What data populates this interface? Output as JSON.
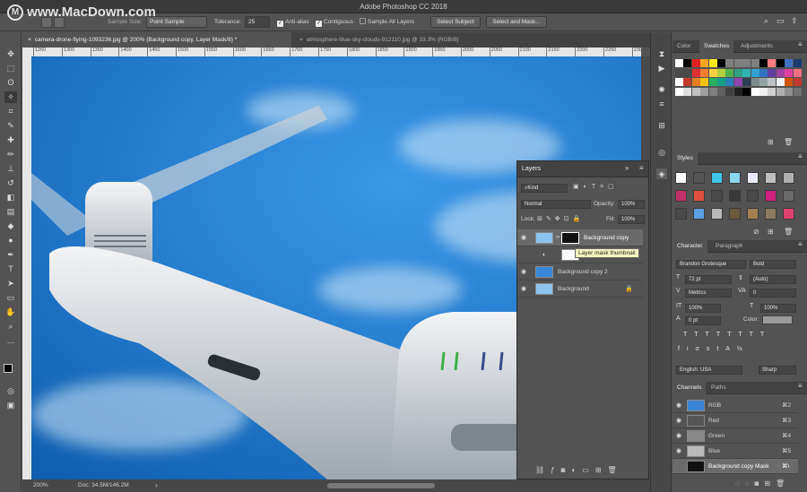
{
  "window": {
    "title": "Adobe Photoshop CC 2018",
    "watermark": "www.MacDown.com"
  },
  "options": {
    "sample_size_label": "Sample Size:",
    "sample_size_value": "Point Sample",
    "tolerance_label": "Tolerance:",
    "tolerance_value": "25",
    "anti_alias": "Anti-alias",
    "contiguous": "Contiguous",
    "sample_all_layers": "Sample All Layers",
    "select_subject": "Select Subject",
    "select_and_mask": "Select and Mask..."
  },
  "tabs": [
    {
      "label": "camera-drone-flying-1093236.jpg @ 200% (Background copy, Layer Mask/8) *",
      "active": true
    },
    {
      "label": "atmosphere-blue-sky-clouds-912110.jpg @ 33.3% (RGB/8)",
      "active": false
    }
  ],
  "ruler": [
    "1260",
    "1300",
    "1350",
    "1400",
    "1450",
    "1500",
    "1550",
    "1600",
    "1650",
    "1700",
    "1750",
    "1800",
    "1850",
    "1900",
    "1950",
    "2000",
    "2050",
    "2100",
    "2150",
    "2200",
    "2250",
    "2300"
  ],
  "status": {
    "zoom": "200%",
    "doc": "Doc: 34.5M/146.2M"
  },
  "swatches_panel": {
    "tabs": [
      "Color",
      "Swatches",
      "Adjustments"
    ],
    "active": "Swatches",
    "rows": [
      [
        "#ffffff",
        "#000000",
        "#e02020",
        "#f5a623",
        "#f8e71c",
        "#000000",
        "#7f7f7f",
        "#7f7f7f",
        "#7f7f7f",
        "#7f7f7f",
        "#000000",
        "#ff7f7f",
        "#000000",
        "#3f6fbf",
        "#1a3a6f"
      ],
      [
        "#4a4a4a",
        "#4a4a4a",
        "#e03030",
        "#f08030",
        "#f8d040",
        "#b0d040",
        "#50b050",
        "#30a080",
        "#30b0b0",
        "#30a0d0",
        "#3070c0",
        "#6040a0",
        "#a040a0",
        "#e040a0",
        "#f07080"
      ],
      [
        "#ffffff",
        "#c0392b",
        "#e67e22",
        "#f1c40f",
        "#27ae60",
        "#16a085",
        "#2980b9",
        "#8e44ad",
        "#2c3e50",
        "#7f8c8d",
        "#95a5a6",
        "#bdc3c7",
        "#ecf0f1",
        "#d35400",
        "#c0392b"
      ],
      [
        "#ffffff",
        "#e0e0e0",
        "#c0c0c0",
        "#a0a0a0",
        "#808080",
        "#606060",
        "#404040",
        "#202020",
        "#000000",
        "#ffffff",
        "#f0f0f0",
        "#d0d0d0",
        "#b0b0b0",
        "#909090",
        "#707070"
      ]
    ]
  },
  "styles_panel": {
    "title": "Styles"
  },
  "character_panel": {
    "tabs": [
      "Character",
      "Paragraph"
    ],
    "font": "Brandon Grotesque",
    "style": "Bold",
    "size": "72 pt",
    "leading": "(Auto)",
    "kerning": "Metrics",
    "tracking": "0",
    "scale_v": "100%",
    "scale_h": "100%",
    "baseline": "0 pt",
    "color_label": "Color:",
    "language": "English: USA",
    "aa": "Sharp"
  },
  "channels_panel": {
    "tabs": [
      "Channels",
      "Paths"
    ],
    "rows": [
      {
        "name": "RGB",
        "key": "⌘2"
      },
      {
        "name": "Red",
        "key": "⌘3"
      },
      {
        "name": "Green",
        "key": "⌘4"
      },
      {
        "name": "Blue",
        "key": "⌘5"
      },
      {
        "name": "Background copy Mask",
        "key": "⌘\\"
      }
    ]
  },
  "layers_panel": {
    "title": "Layers",
    "filter": "Kind",
    "blend_mode": "Normal",
    "opacity_label": "Opacity:",
    "opacity": "100%",
    "lock_label": "Lock:",
    "fill_label": "Fill:",
    "fill": "100%",
    "layers": [
      {
        "name": "Background copy"
      },
      {
        "name": "Background"
      },
      {
        "name": "Background copy 2"
      },
      {
        "name": "Background"
      }
    ],
    "tooltip": "Layer mask thumbnail"
  },
  "colors": {
    "sky": "#1f7fd2",
    "panel": "#535353",
    "accent": "#4a90d9"
  }
}
